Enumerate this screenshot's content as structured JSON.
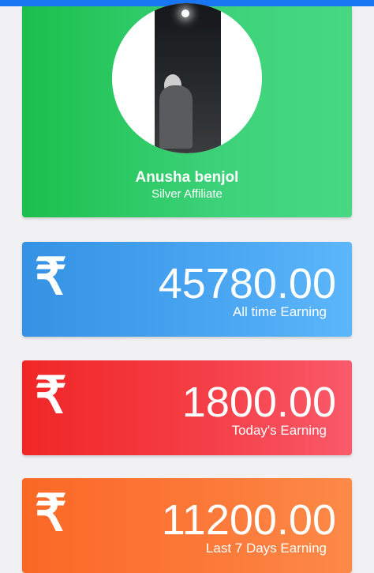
{
  "profile": {
    "name": "Anusha benjol",
    "role": "Silver Affiliate"
  },
  "currency_icon": "rupee-icon",
  "cards": [
    {
      "amount": "45780.00",
      "label": "All time Earning",
      "color": "#3a9be9"
    },
    {
      "amount": "1800.00",
      "label": "Today's Earning",
      "color": "#f23038"
    },
    {
      "amount": "11200.00",
      "label": "Last 7 Days Earning",
      "color": "#fb6f2e"
    }
  ],
  "colors": {
    "profile_card": "#2fca63",
    "top_bar": "#1976f2"
  }
}
